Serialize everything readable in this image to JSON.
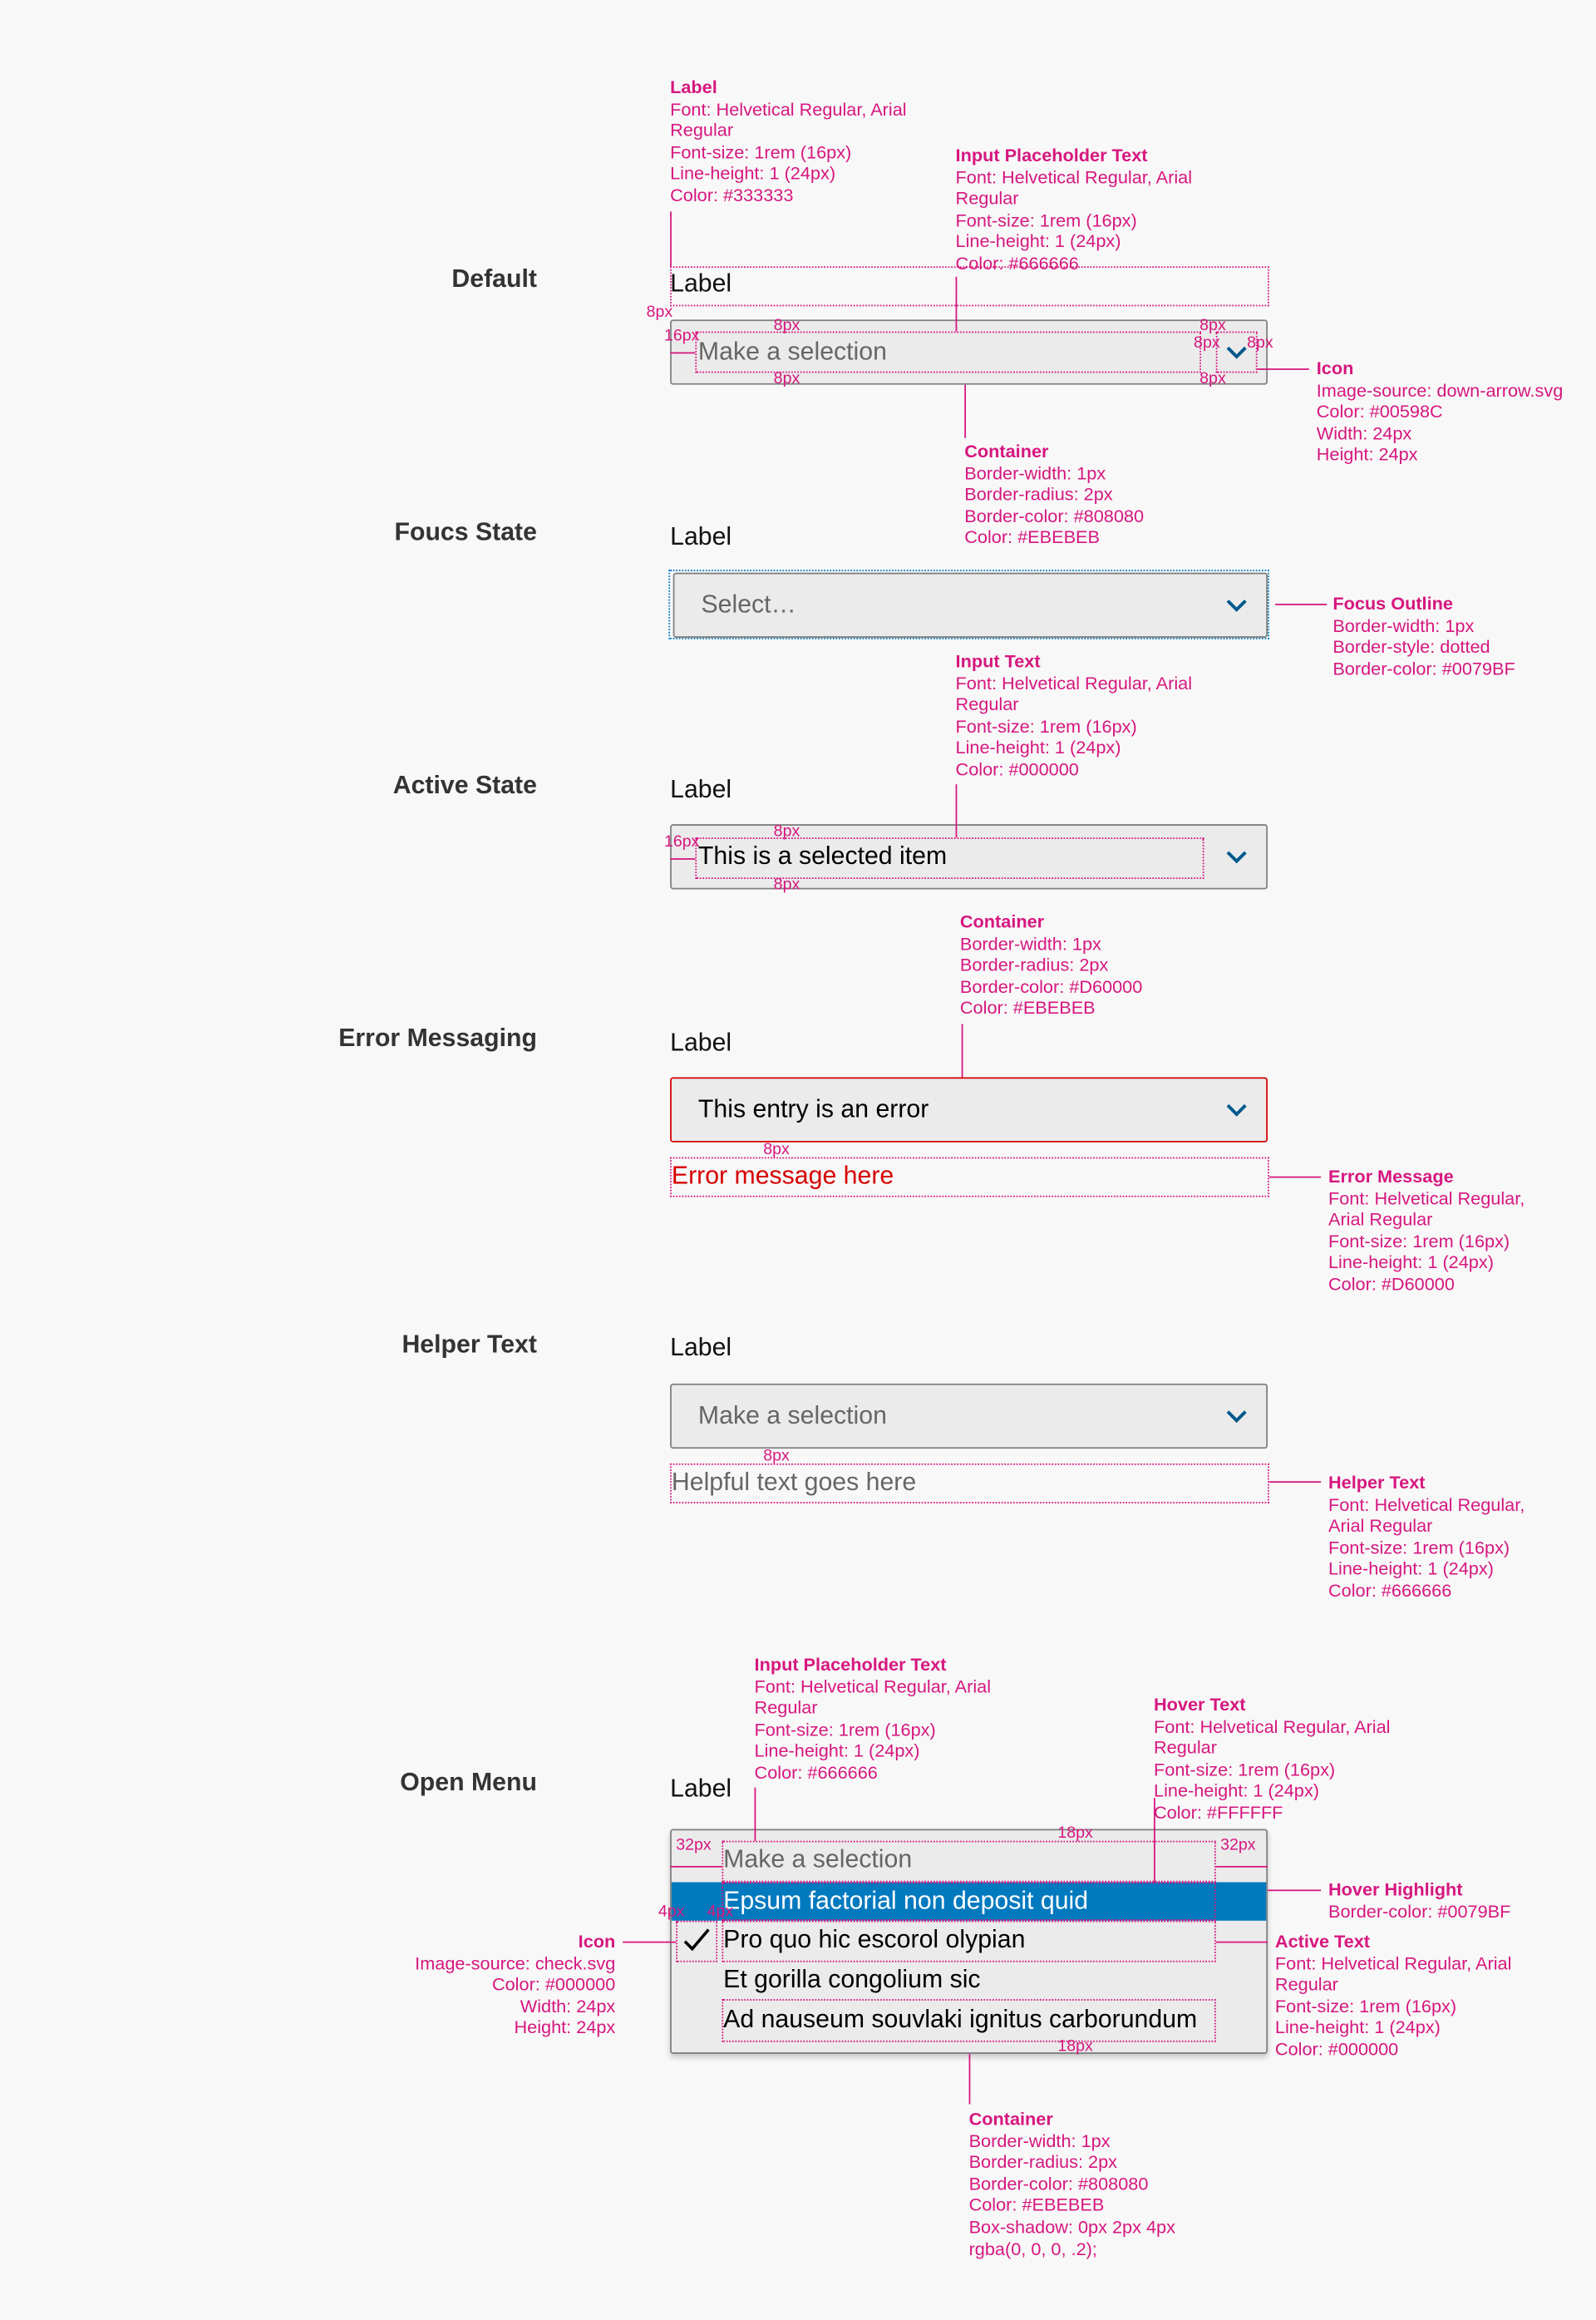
{
  "colors": {
    "annotation": "#D6177F",
    "chevron": "#00598C",
    "focus_outline": "#0079BF",
    "error": "#D60000",
    "hover": "#0079BF",
    "container": "#EBEBEB",
    "border": "#808080"
  },
  "icons": {
    "chevron": "chevron-down-icon",
    "check": "check-icon"
  },
  "sections": {
    "default": {
      "heading": "Default",
      "label": "Label",
      "placeholder": "Make a selection"
    },
    "focus": {
      "heading": "Foucs State",
      "label": "Label",
      "placeholder": "Select…"
    },
    "active": {
      "heading": "Active State",
      "label": "Label",
      "value": "This is a selected item"
    },
    "error": {
      "heading": "Error Messaging",
      "label": "Label",
      "value": "This entry is an error",
      "message": "Error message here"
    },
    "helper": {
      "heading": "Helper Text",
      "label": "Label",
      "placeholder": "Make a selection",
      "helper": "Helpful text goes here"
    },
    "open": {
      "heading": "Open Menu",
      "label": "Label",
      "placeholder": "Make a selection",
      "options": [
        "Epsum factorial non deposit quid",
        "Pro quo hic escorol olypian",
        "Et gorilla congolium sic",
        "Ad nauseum souvlaki ignitus carborundum"
      ],
      "hovered_index": 0,
      "selected_index": 1
    }
  },
  "annotations": {
    "default_label": {
      "title": "Label",
      "lines": [
        "Font: Helvetical Regular, Arial",
        "Regular",
        "Font-size: 1rem (16px)",
        "Line-height: 1 (24px)",
        "Color: #333333"
      ]
    },
    "default_placeholder": {
      "title": "Input Placeholder Text",
      "lines": [
        "Font: Helvetical Regular, Arial",
        "Regular",
        "Font-size: 1rem (16px)",
        "Line-height: 1 (24px)",
        "Color: #666666"
      ]
    },
    "default_icon": {
      "title": "Icon",
      "lines": [
        "Image-source: down-arrow.svg",
        "Color: #00598C",
        "Width: 24px",
        "Height: 24px"
      ]
    },
    "default_container": {
      "title": "Container",
      "lines": [
        "Border-width: 1px",
        "Border-radius: 2px",
        "Border-color: #808080",
        "Color: #EBEBEB"
      ]
    },
    "focus_outline": {
      "title": "Focus Outline",
      "lines": [
        "Border-width: 1px",
        "Border-style: dotted",
        "Border-color: #0079BF"
      ]
    },
    "input_text": {
      "title": "Input Text",
      "lines": [
        "Font: Helvetical Regular, Arial",
        "Regular",
        "Font-size: 1rem (16px)",
        "Line-height: 1 (24px)",
        "Color: #000000"
      ]
    },
    "error_container": {
      "title": "Container",
      "lines": [
        "Border-width: 1px",
        "Border-radius: 2px",
        "Border-color: #D60000",
        "Color: #EBEBEB"
      ]
    },
    "error_message": {
      "title": "Error Message",
      "lines": [
        "Font: Helvetical Regular,",
        "Arial Regular",
        "Font-size: 1rem (16px)",
        "Line-height: 1 (24px)",
        "Color: #D60000"
      ]
    },
    "helper_text": {
      "title": "Helper Text",
      "lines": [
        "Font: Helvetical Regular,",
        "Arial Regular",
        "Font-size: 1rem (16px)",
        "Line-height: 1 (24px)",
        "Color: #666666"
      ]
    },
    "open_placeholder": {
      "title": "Input Placeholder Text",
      "lines": [
        "Font: Helvetical Regular, Arial",
        "Regular",
        "Font-size: 1rem (16px)",
        "Line-height: 1 (24px)",
        "Color: #666666"
      ]
    },
    "hover_text": {
      "title": "Hover Text",
      "lines": [
        "Font: Helvetical Regular, Arial",
        "Regular",
        "Font-size: 1rem (16px)",
        "Line-height: 1 (24px)",
        "Color: #FFFFFF"
      ]
    },
    "hover_highlight": {
      "title": "Hover Highlight",
      "lines": [
        "Border-color: #0079BF"
      ]
    },
    "active_text": {
      "title": "Active Text",
      "lines": [
        "Font: Helvetical Regular, Arial",
        "Regular",
        "Font-size: 1rem (16px)",
        "Line-height: 1 (24px)",
        "Color: #000000"
      ]
    },
    "check_icon": {
      "title": "Icon",
      "lines": [
        "Image-source: check.svg",
        "Color: #000000",
        "Width: 24px",
        "Height: 24px"
      ]
    },
    "menu_container": {
      "title": "Container",
      "lines": [
        "Border-width: 1px",
        "Border-radius: 2px",
        "Border-color: #808080",
        "Color: #EBEBEB",
        "Box-shadow: 0px 2px 4px",
        "rgba(0, 0, 0, .2);"
      ]
    }
  },
  "measurements": {
    "px8": "8px",
    "px16": "16px",
    "px32": "32px",
    "px18": "18px",
    "px4": "4px"
  }
}
